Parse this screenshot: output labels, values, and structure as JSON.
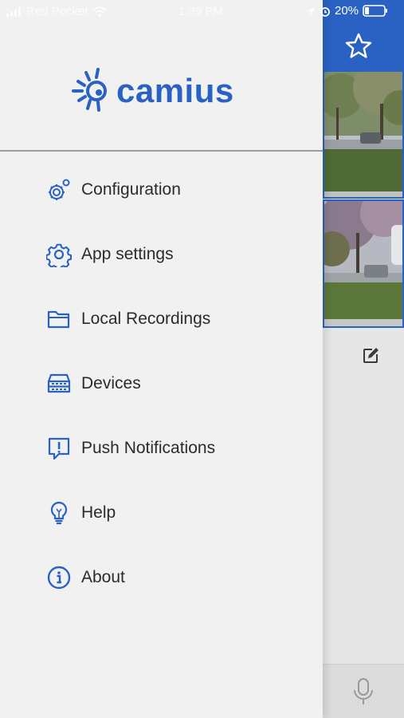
{
  "status_bar": {
    "carrier": "Red Pocket",
    "time": "1:39 PM",
    "battery": "20%"
  },
  "brand": {
    "name": "camius",
    "color": "#2a62c4"
  },
  "menu": [
    {
      "label": "Configuration",
      "icon": "gears-icon"
    },
    {
      "label": "App settings",
      "icon": "gear-icon"
    },
    {
      "label": "Local Recordings",
      "icon": "folder-icon"
    },
    {
      "label": "Devices",
      "icon": "server-icon"
    },
    {
      "label": "Push Notifications",
      "icon": "alert-bubble-icon"
    },
    {
      "label": "Help",
      "icon": "lightbulb-icon"
    },
    {
      "label": "About",
      "icon": "info-icon"
    }
  ],
  "background_app": {
    "header_color": "#2a62c4",
    "icons": [
      "star-icon",
      "edit-icon",
      "microphone-icon"
    ]
  }
}
